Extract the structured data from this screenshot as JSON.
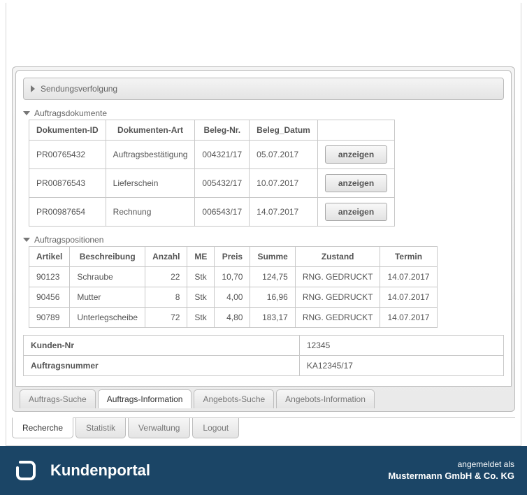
{
  "header": {
    "title": "Kundenportal",
    "logged_in_as": "angemeldet als",
    "company": "Mustermann GmbH & Co. KG"
  },
  "main_tabs": [
    "Recherche",
    "Statistik",
    "Verwaltung",
    "Logout"
  ],
  "main_tab_active": 0,
  "sub_tabs": [
    "Auftrags-Suche",
    "Auftrags-Information",
    "Angebots-Suche",
    "Angebots-Information"
  ],
  "sub_tab_active": 1,
  "order_info": {
    "kunden_nr_label": "Kunden-Nr",
    "kunden_nr": "12345",
    "auftragsnummer_label": "Auftragsnummer",
    "auftragsnummer": "KA12345/17"
  },
  "positions": {
    "title": "Auftragspositionen",
    "headers": [
      "Artikel",
      "Beschreibung",
      "Anzahl",
      "ME",
      "Preis",
      "Summe",
      "Zustand",
      "Termin"
    ],
    "rows": [
      {
        "artikel": "90123",
        "beschr": "Schraube",
        "anzahl": "22",
        "me": "Stk",
        "preis": "10,70",
        "summe": "124,75",
        "zustand": "RNG. GEDRUCKT",
        "termin": "14.07.2017"
      },
      {
        "artikel": "90456",
        "beschr": "Mutter",
        "anzahl": "8",
        "me": "Stk",
        "preis": "4,00",
        "summe": "16,96",
        "zustand": "RNG. GEDRUCKT",
        "termin": "14.07.2017"
      },
      {
        "artikel": "90789",
        "beschr": "Unterlegscheibe",
        "anzahl": "72",
        "me": "Stk",
        "preis": "4,80",
        "summe": "183,17",
        "zustand": "RNG. GEDRUCKT",
        "termin": "14.07.2017"
      }
    ]
  },
  "documents": {
    "title": "Auftragsdokumente",
    "headers": [
      "Dokumenten-ID",
      "Dokumenten-Art",
      "Beleg-Nr.",
      "Beleg_Datum",
      ""
    ],
    "show_label": "anzeigen",
    "rows": [
      {
        "id": "PR00765432",
        "art": "Auftragsbestätigung",
        "belegnr": "004321/17",
        "datum": "05.07.2017"
      },
      {
        "id": "PR00876543",
        "art": "Lieferschein",
        "belegnr": "005432/17",
        "datum": "10.07.2017"
      },
      {
        "id": "PR00987654",
        "art": "Rechnung",
        "belegnr": "006543/17",
        "datum": "14.07.2017"
      }
    ]
  },
  "tracking": {
    "title": "Sendungsverfolgung"
  }
}
